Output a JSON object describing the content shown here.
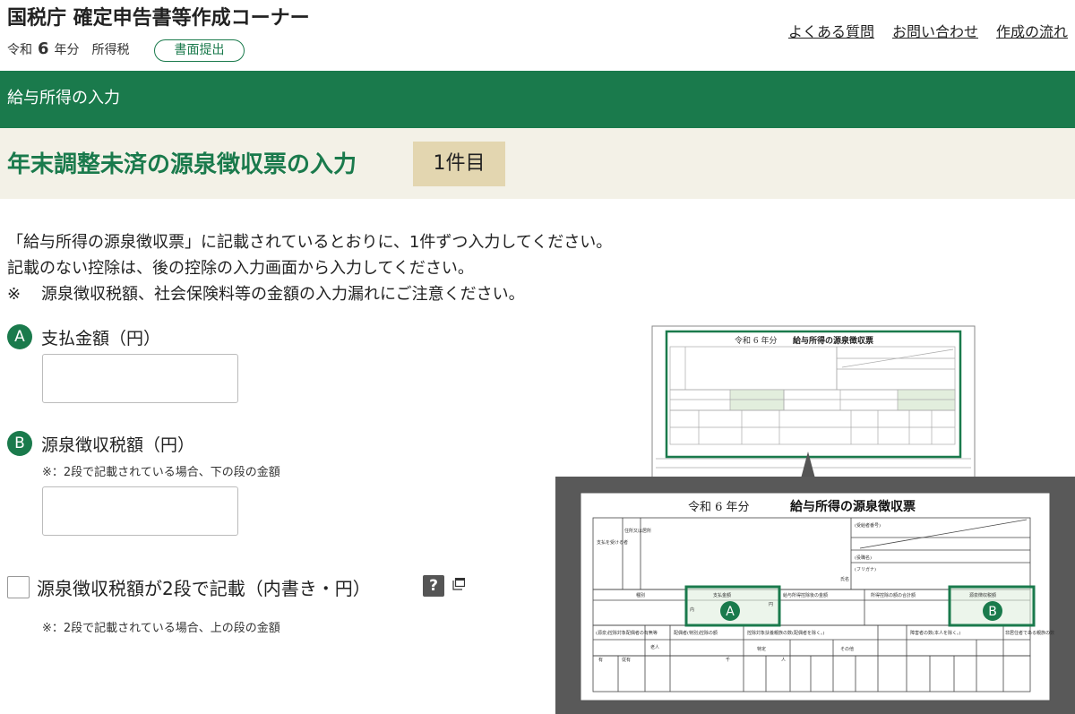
{
  "header": {
    "site_title": "国税庁 確定申告書等作成コーナー",
    "era": "令和",
    "year": "6",
    "year_suffix": "年分",
    "tax_type": "所得税",
    "mode_badge": "書面提出",
    "links": [
      "よくある質問",
      "お問い合わせ",
      "作成の流れ"
    ]
  },
  "section_bar": {
    "label": "給与所得の入力"
  },
  "title_band": {
    "title": "年末調整未済の源泉徴収票の入力",
    "count": "1件目"
  },
  "instructions": {
    "line1": "「給与所得の源泉徴収票」に記載されているとおりに、1件ずつ入力してください。",
    "line2": "記載のない控除は、後の控除の入力画面から入力してください。",
    "line3_mark": "※",
    "line3": "源泉徴収税額、社会保険料等の金額の入力漏れにご注意ください。"
  },
  "form": {
    "field_a": {
      "marker": "A",
      "label": "支払金額（円）",
      "value": ""
    },
    "field_b": {
      "marker": "B",
      "label": "源泉徴収税額（円）",
      "note": "※：2段で記載されている場合、下の段の金額",
      "value": ""
    },
    "two_tier": {
      "label": "源泉徴収税額が2段で記載（内書き・円）",
      "help_label": "?",
      "note": "※：2段で記載されている場合、上の段の金額",
      "checked": false
    }
  },
  "illustration": {
    "small_year": "令和 6 年分",
    "small_title": "給与所得の源泉徴収票",
    "big_year": "令和 6 年分",
    "big_title": "給与所得の源泉徴収票",
    "marker_a": "A",
    "marker_b": "B",
    "cell_payee": "支払を受ける者",
    "cell_address": "住所又は居所",
    "cell_type": "種別",
    "cell_payment": "支払金額",
    "cell_after_deduction": "給与所得控除後の金額",
    "cell_total_deduction": "所得控除の額の合計額",
    "cell_tax": "源泉徴収税額",
    "cell_kana": "(フリガナ)",
    "cell_name": "氏名",
    "cell_role": "(役職名)",
    "cell_recipient_no": "(受給者番号)",
    "cell_spouse": "(源泉)控除対象配偶者の有無等",
    "cell_elderly": "老人",
    "cell_spouse_special": "配偶者(特別)控除の額",
    "cell_dependents": "控除対象扶養親族の数(配偶者を除く。)",
    "cell_specific": "特定",
    "cell_other": "その他",
    "cell_disabled": "障害者の数(本人を除く。)",
    "cell_nonresident": "非居住者である親族の数",
    "cell_yes": "有",
    "cell_sub": "従有",
    "cell_inner": "内",
    "cell_yen": "円",
    "cell_thousand": "千",
    "cell_person": "人"
  },
  "colors": {
    "brand_green": "#1a7a4c",
    "band_beige": "#f3f1e7",
    "badge_tan": "#e3d6b0",
    "dark_frame": "#595959"
  }
}
